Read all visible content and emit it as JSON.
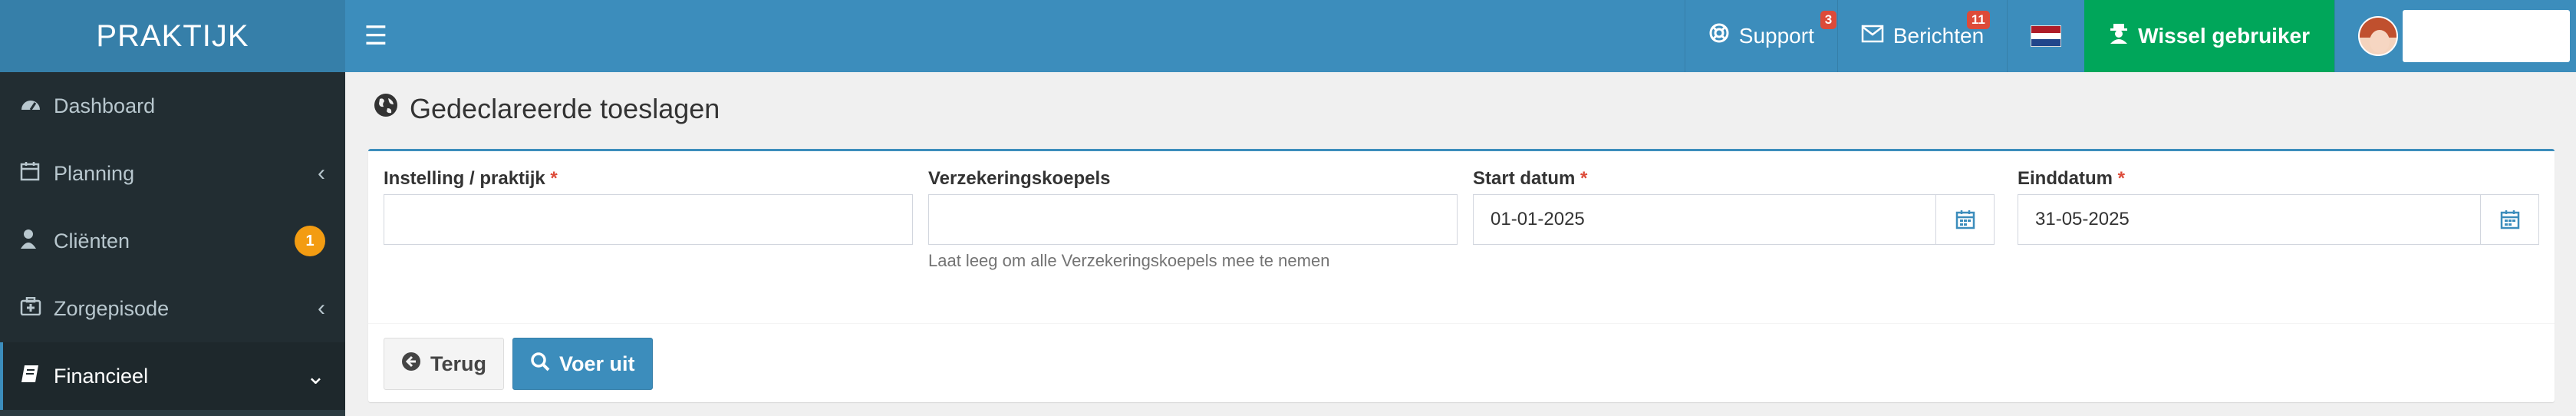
{
  "app": {
    "logo": "PRAKTIJK"
  },
  "header": {
    "menu_icon": "hamburger-icon",
    "support": {
      "label": "Support",
      "badge": "3",
      "icon": "lifebuoy-icon"
    },
    "messages": {
      "label": "Berichten",
      "badge": "11",
      "icon": "envelope-icon"
    },
    "language": {
      "flag": "NL",
      "colors": [
        "#ae1c28",
        "#ffffff",
        "#21468b"
      ]
    },
    "switch_user": {
      "label": "Wissel gebruiker",
      "icon": "user-secret-icon"
    }
  },
  "sidebar": {
    "items": [
      {
        "label": "Dashboard",
        "icon": "dashboard-icon"
      },
      {
        "label": "Planning",
        "icon": "calendar-icon",
        "chevron": "‹"
      },
      {
        "label": "Cliënten",
        "icon": "user-icon",
        "badge": "1"
      },
      {
        "label": "Zorgepisode",
        "icon": "medkit-icon",
        "chevron": "‹"
      },
      {
        "label": "Financieel",
        "icon": "book-icon",
        "chevron": "⌄",
        "active": true
      }
    ]
  },
  "page": {
    "title": "Gedeclareerde toeslagen",
    "title_icon": "globe-icon"
  },
  "form": {
    "institution": {
      "label": "Instelling / praktijk",
      "required": "*",
      "value": ""
    },
    "insurers": {
      "label": "Verzekeringskoepels",
      "value": "",
      "help": "Laat leeg om alle Verzekeringskoepels mee te nemen"
    },
    "start_date": {
      "label": "Start datum",
      "required": "*",
      "value": "01-01-2025"
    },
    "end_date": {
      "label": "Einddatum",
      "required": "*",
      "value": "31-05-2025"
    }
  },
  "buttons": {
    "back": {
      "label": "Terug",
      "icon": "arrow-circle-left-icon"
    },
    "run": {
      "label": "Voer uit",
      "icon": "search-icon"
    }
  },
  "colors": {
    "header": "#3c8dbc",
    "logo_bg": "#367fa9",
    "sidebar": "#222d32",
    "switch_user": "#00a65a",
    "badge_red": "#dd4b39",
    "badge_orange": "#f39c12"
  }
}
